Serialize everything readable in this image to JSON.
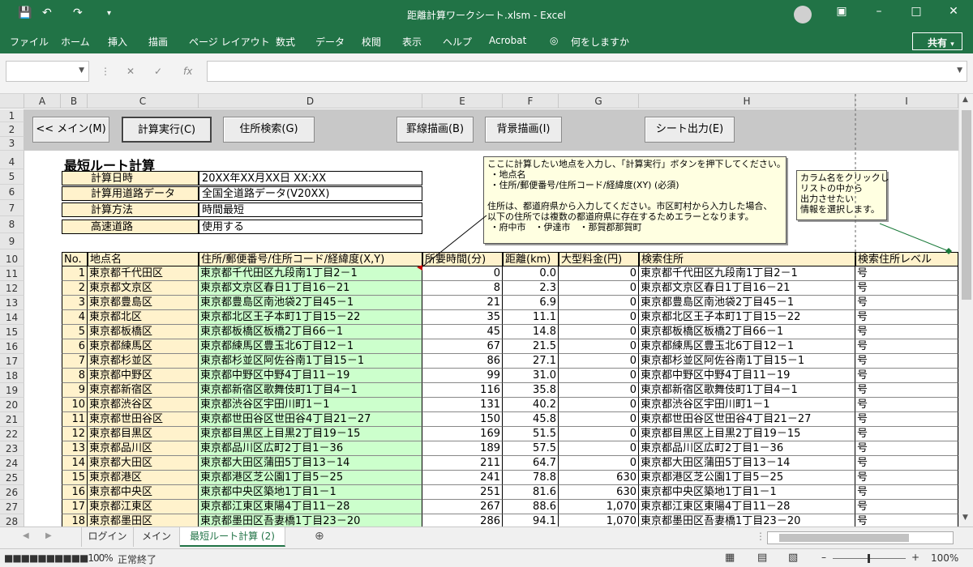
{
  "window": {
    "title": "距離計算ワークシート.xlsm - Excel"
  },
  "menu": [
    "ファイル",
    "ホーム",
    "挿入",
    "描画",
    "ページ レイアウト",
    "数式",
    "データ",
    "校閲",
    "表示",
    "ヘルプ",
    "Acrobat",
    "何をしますか"
  ],
  "share_label": "共有",
  "columns": [
    "A",
    "B",
    "C",
    "D",
    "E",
    "F",
    "G",
    "H",
    "I"
  ],
  "row_numbers": [
    "1",
    "2",
    "3",
    "4",
    "5",
    "6",
    "7",
    "8",
    "9",
    "10",
    "11",
    "12",
    "13",
    "14",
    "15",
    "16",
    "17",
    "18",
    "19",
    "20",
    "21",
    "22",
    "23",
    "24",
    "25",
    "26",
    "27",
    "28"
  ],
  "buttons": {
    "main": "<< メイン(M)",
    "calc": "計算実行(C)",
    "address": "住所検索(G)",
    "border": "罫線描画(B)",
    "background": "背景描画(I)",
    "export": "シート出力(E)"
  },
  "sheet_title": "最短ルート計算",
  "info": [
    {
      "label": "計算日時",
      "value": "20XX年XX月XX日 XX:XX"
    },
    {
      "label": "計算用道路データ",
      "value": "全国全道路データ(V20XX)"
    },
    {
      "label": "計算方法",
      "value": "時間最短"
    },
    {
      "label": "高速道路",
      "value": "使用する"
    }
  ],
  "headers": {
    "no": "No.",
    "point": "地点名",
    "address": "住所/郵便番号/住所コード/経緯度(X,Y)",
    "time": "所要時間(分)",
    "distance": "距離(km)",
    "toll": "大型料金(円)",
    "search_address": "検索住所",
    "level": "検索住所レベル"
  },
  "rows": [
    {
      "no": "1",
      "point": "東京都千代田区",
      "address": "東京都千代田区九段南1丁目2－1",
      "time": "0",
      "distance": "0.0",
      "toll": "0",
      "search": "東京都千代田区九段南1丁目2－1",
      "level": "号"
    },
    {
      "no": "2",
      "point": "東京都文京区",
      "address": "東京都文京区春日1丁目16－21",
      "time": "8",
      "distance": "2.3",
      "toll": "0",
      "search": "東京都文京区春日1丁目16－21",
      "level": "号"
    },
    {
      "no": "3",
      "point": "東京都豊島区",
      "address": "東京都豊島区南池袋2丁目45－1",
      "time": "21",
      "distance": "6.9",
      "toll": "0",
      "search": "東京都豊島区南池袋2丁目45－1",
      "level": "号"
    },
    {
      "no": "4",
      "point": "東京都北区",
      "address": "東京都北区王子本町1丁目15－22",
      "time": "35",
      "distance": "11.1",
      "toll": "0",
      "search": "東京都北区王子本町1丁目15－22",
      "level": "号"
    },
    {
      "no": "5",
      "point": "東京都板橋区",
      "address": "東京都板橋区板橋2丁目66－1",
      "time": "45",
      "distance": "14.8",
      "toll": "0",
      "search": "東京都板橋区板橋2丁目66－1",
      "level": "号"
    },
    {
      "no": "6",
      "point": "東京都練馬区",
      "address": "東京都練馬区豊玉北6丁目12－1",
      "time": "67",
      "distance": "21.5",
      "toll": "0",
      "search": "東京都練馬区豊玉北6丁目12－1",
      "level": "号"
    },
    {
      "no": "7",
      "point": "東京都杉並区",
      "address": "東京都杉並区阿佐谷南1丁目15－1",
      "time": "86",
      "distance": "27.1",
      "toll": "0",
      "search": "東京都杉並区阿佐谷南1丁目15－1",
      "level": "号"
    },
    {
      "no": "8",
      "point": "東京都中野区",
      "address": "東京都中野区中野4丁目11－19",
      "time": "99",
      "distance": "31.0",
      "toll": "0",
      "search": "東京都中野区中野4丁目11－19",
      "level": "号"
    },
    {
      "no": "9",
      "point": "東京都新宿区",
      "address": "東京都新宿区歌舞伎町1丁目4－1",
      "time": "116",
      "distance": "35.8",
      "toll": "0",
      "search": "東京都新宿区歌舞伎町1丁目4－1",
      "level": "号"
    },
    {
      "no": "10",
      "point": "東京都渋谷区",
      "address": "東京都渋谷区宇田川町1－1",
      "time": "131",
      "distance": "40.2",
      "toll": "0",
      "search": "東京都渋谷区宇田川町1－1",
      "level": "号"
    },
    {
      "no": "11",
      "point": "東京都世田谷区",
      "address": "東京都世田谷区世田谷4丁目21－27",
      "time": "150",
      "distance": "45.8",
      "toll": "0",
      "search": "東京都世田谷区世田谷4丁目21－27",
      "level": "号"
    },
    {
      "no": "12",
      "point": "東京都目黒区",
      "address": "東京都目黒区上目黒2丁目19－15",
      "time": "169",
      "distance": "51.5",
      "toll": "0",
      "search": "東京都目黒区上目黒2丁目19－15",
      "level": "号"
    },
    {
      "no": "13",
      "point": "東京都品川区",
      "address": "東京都品川区広町2丁目1－36",
      "time": "189",
      "distance": "57.5",
      "toll": "0",
      "search": "東京都品川区広町2丁目1－36",
      "level": "号"
    },
    {
      "no": "14",
      "point": "東京都大田区",
      "address": "東京都大田区蒲田5丁目13－14",
      "time": "211",
      "distance": "64.7",
      "toll": "0",
      "search": "東京都大田区蒲田5丁目13－14",
      "level": "号"
    },
    {
      "no": "15",
      "point": "東京都港区",
      "address": "東京都港区芝公園1丁目5－25",
      "time": "241",
      "distance": "78.8",
      "toll": "630",
      "search": "東京都港区芝公園1丁目5－25",
      "level": "号"
    },
    {
      "no": "16",
      "point": "東京都中央区",
      "address": "東京都中央区築地1丁目1－1",
      "time": "251",
      "distance": "81.6",
      "toll": "630",
      "search": "東京都中央区築地1丁目1－1",
      "level": "号"
    },
    {
      "no": "17",
      "point": "東京都江東区",
      "address": "東京都江東区東陽4丁目11－28",
      "time": "267",
      "distance": "88.6",
      "toll": "1,070",
      "search": "東京都江東区東陽4丁目11－28",
      "level": "号"
    },
    {
      "no": "18",
      "point": "東京都墨田区",
      "address": "東京都墨田区吾妻橋1丁目23－20",
      "time": "286",
      "distance": "94.1",
      "toll": "1,070",
      "search": "東京都墨田区吾妻橋1丁目23－20",
      "level": "号"
    }
  ],
  "notes": {
    "input_note": "ここに計算したい地点を入力し、「計算実行」ボタンを押下してください。\n ・地点名\n ・住所/郵便番号/住所コード/経緯度(XY) (必須)\n\n住所は、都道府県から入力してください。市区町村から入力した場合、\n以下の住所では複数の都道府県に存在するためエラーとなります。\n ・府中市　・伊達市　・那賀郡那賀町",
    "column_note": "カラム名をクリックし\nリストの中から\n出力させたい\n情報を選択します。"
  },
  "tabs": [
    "ログイン",
    "メイン",
    "最短ルート計算 (2)"
  ],
  "status": {
    "progress_text": "■■■■■■■■■■100%",
    "mode": "正常終了",
    "zoom": "100%"
  },
  "colors": {
    "excel_green": "#217346",
    "header_yellow": "#fff2cc",
    "input_green": "#ccffcc"
  }
}
